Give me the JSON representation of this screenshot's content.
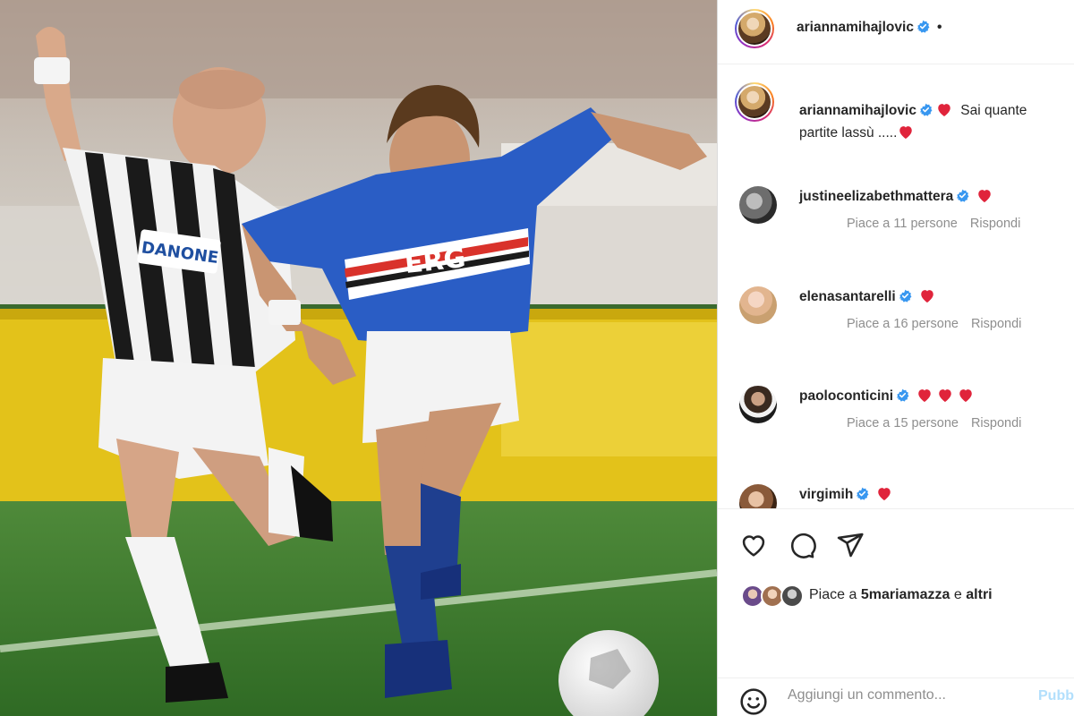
{
  "photo": {
    "alt_text": "",
    "sponsor_left": "DANONE",
    "sponsor_right": "ERG"
  },
  "post": {
    "author": "ariannamihajlovic",
    "follow_dot": "•",
    "caption_line1": "Sai quante",
    "caption_line2": "partite lassù .....",
    "verified_color": "#3897f0",
    "heart_color": "#ed4956"
  },
  "comments": [
    {
      "username": "justineelizabethmattera",
      "hearts": 1,
      "likes": "Piace a 11 persone",
      "reply": "Rispondi"
    },
    {
      "username": "elenasantarelli",
      "hearts": 1,
      "likes": "Piace a 16 persone",
      "reply": "Rispondi"
    },
    {
      "username": "paoloconticini",
      "hearts": 3,
      "likes": "Piace a 15 persone",
      "reply": "Rispondi"
    },
    {
      "username": "virgimih",
      "hearts": 1,
      "likes": "",
      "reply": ""
    }
  ],
  "actions": {
    "like_icon": "heart-outline-icon",
    "comment_icon": "comment-bubble-icon",
    "share_icon": "paper-plane-icon",
    "likes_prefix": "Piace a",
    "likes_user": "5mariamazza",
    "likes_connector": "e",
    "likes_suffix": "altri"
  },
  "add_comment": {
    "placeholder": "Aggiungi un commento...",
    "publish_label": "Pubblica",
    "emoji_icon": "smiley-icon"
  }
}
